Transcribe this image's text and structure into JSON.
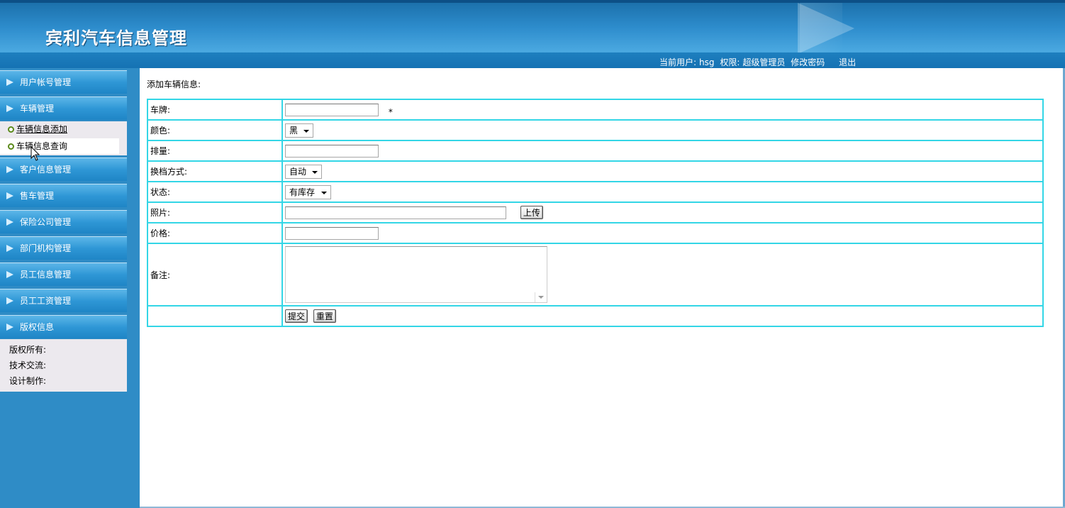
{
  "header": {
    "app_title": "宾利汽车信息管理",
    "current_user_label": "当前用户:",
    "current_user": "hsg",
    "role_label": "权限:",
    "role": "超级管理员",
    "change_password": "修改密码",
    "logout": "退出"
  },
  "sidebar": {
    "menus": [
      {
        "label": "用户帐号管理"
      },
      {
        "label": "车辆管理"
      },
      {
        "label": "客户信息管理"
      },
      {
        "label": "售车管理"
      },
      {
        "label": "保险公司管理"
      },
      {
        "label": "部门机构管理"
      },
      {
        "label": "员工信息管理"
      },
      {
        "label": "员工工资管理"
      },
      {
        "label": "版权信息"
      }
    ],
    "submenu": [
      {
        "label": "车辆信息添加"
      },
      {
        "label": "车辆信息查询"
      }
    ],
    "info": {
      "copyright": "版权所有:",
      "tech": "技术交流:",
      "design": "设计制作:"
    }
  },
  "main": {
    "section_title": "添加车辆信息:",
    "fields": {
      "plate_label": "车牌:",
      "plate_value": "",
      "required_mark": "*",
      "color_label": "颜色:",
      "color_value": "黑",
      "displacement_label": "排量:",
      "displacement_value": "",
      "gear_label": "换档方式:",
      "gear_value": "自动",
      "status_label": "状态:",
      "status_value": "有库存",
      "photo_label": "照片:",
      "photo_value": "",
      "upload_button": "上传",
      "price_label": "价格:",
      "price_value": "",
      "remark_label": "备注:"
    },
    "submit_button": "提交",
    "reset_button": "重置"
  }
}
